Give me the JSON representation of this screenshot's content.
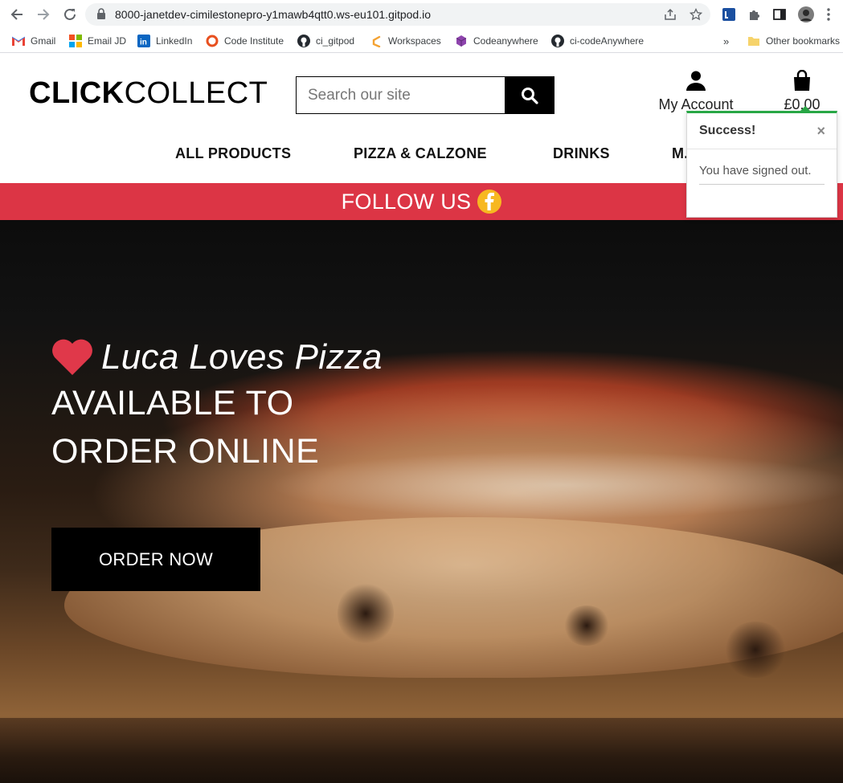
{
  "browser": {
    "url": "8000-janetdev-cimilestonepro-y1mawb4qtt0.ws-eu101.gitpod.io",
    "bookmarks": [
      "Gmail",
      "Email JD",
      "LinkedIn",
      "Code Institute",
      "ci_gitpod",
      "Workspaces",
      "Codeanywhere",
      "ci-codeAnywhere"
    ],
    "overflow": "»",
    "other_bookmarks": "Other bookmarks"
  },
  "site": {
    "logo_bold": "CLICK",
    "logo_light": "COLLECT",
    "search_placeholder": "Search our site",
    "account_label": "My Account",
    "bag_total": "£0.00",
    "nav": [
      "ALL PRODUCTS",
      "PIZZA & CALZONE",
      "DRINKS",
      "M..."
    ],
    "follow_label": "FOLLOW US"
  },
  "hero": {
    "tagline": "Luca Loves Pizza",
    "headline_line1": "AVAILABLE TO",
    "headline_line2": "ORDER ONLINE",
    "cta": "ORDER NOW"
  },
  "toast": {
    "title": "Success!",
    "close": "×",
    "message": "You have signed out."
  },
  "colors": {
    "follow_bar": "#dc3545",
    "toast_accent": "#28a745",
    "facebook_badge": "#f7b820",
    "heart": "#e0384a"
  },
  "icons": [
    "back-icon",
    "forward-icon",
    "reload-icon",
    "lock-icon",
    "share-icon",
    "star-icon",
    "extension-icon",
    "puzzle-icon",
    "sidebar-icon",
    "profile-icon",
    "menu-icon",
    "search-icon",
    "user-icon",
    "shopping-bag-icon",
    "facebook-icon",
    "heart-icon"
  ]
}
